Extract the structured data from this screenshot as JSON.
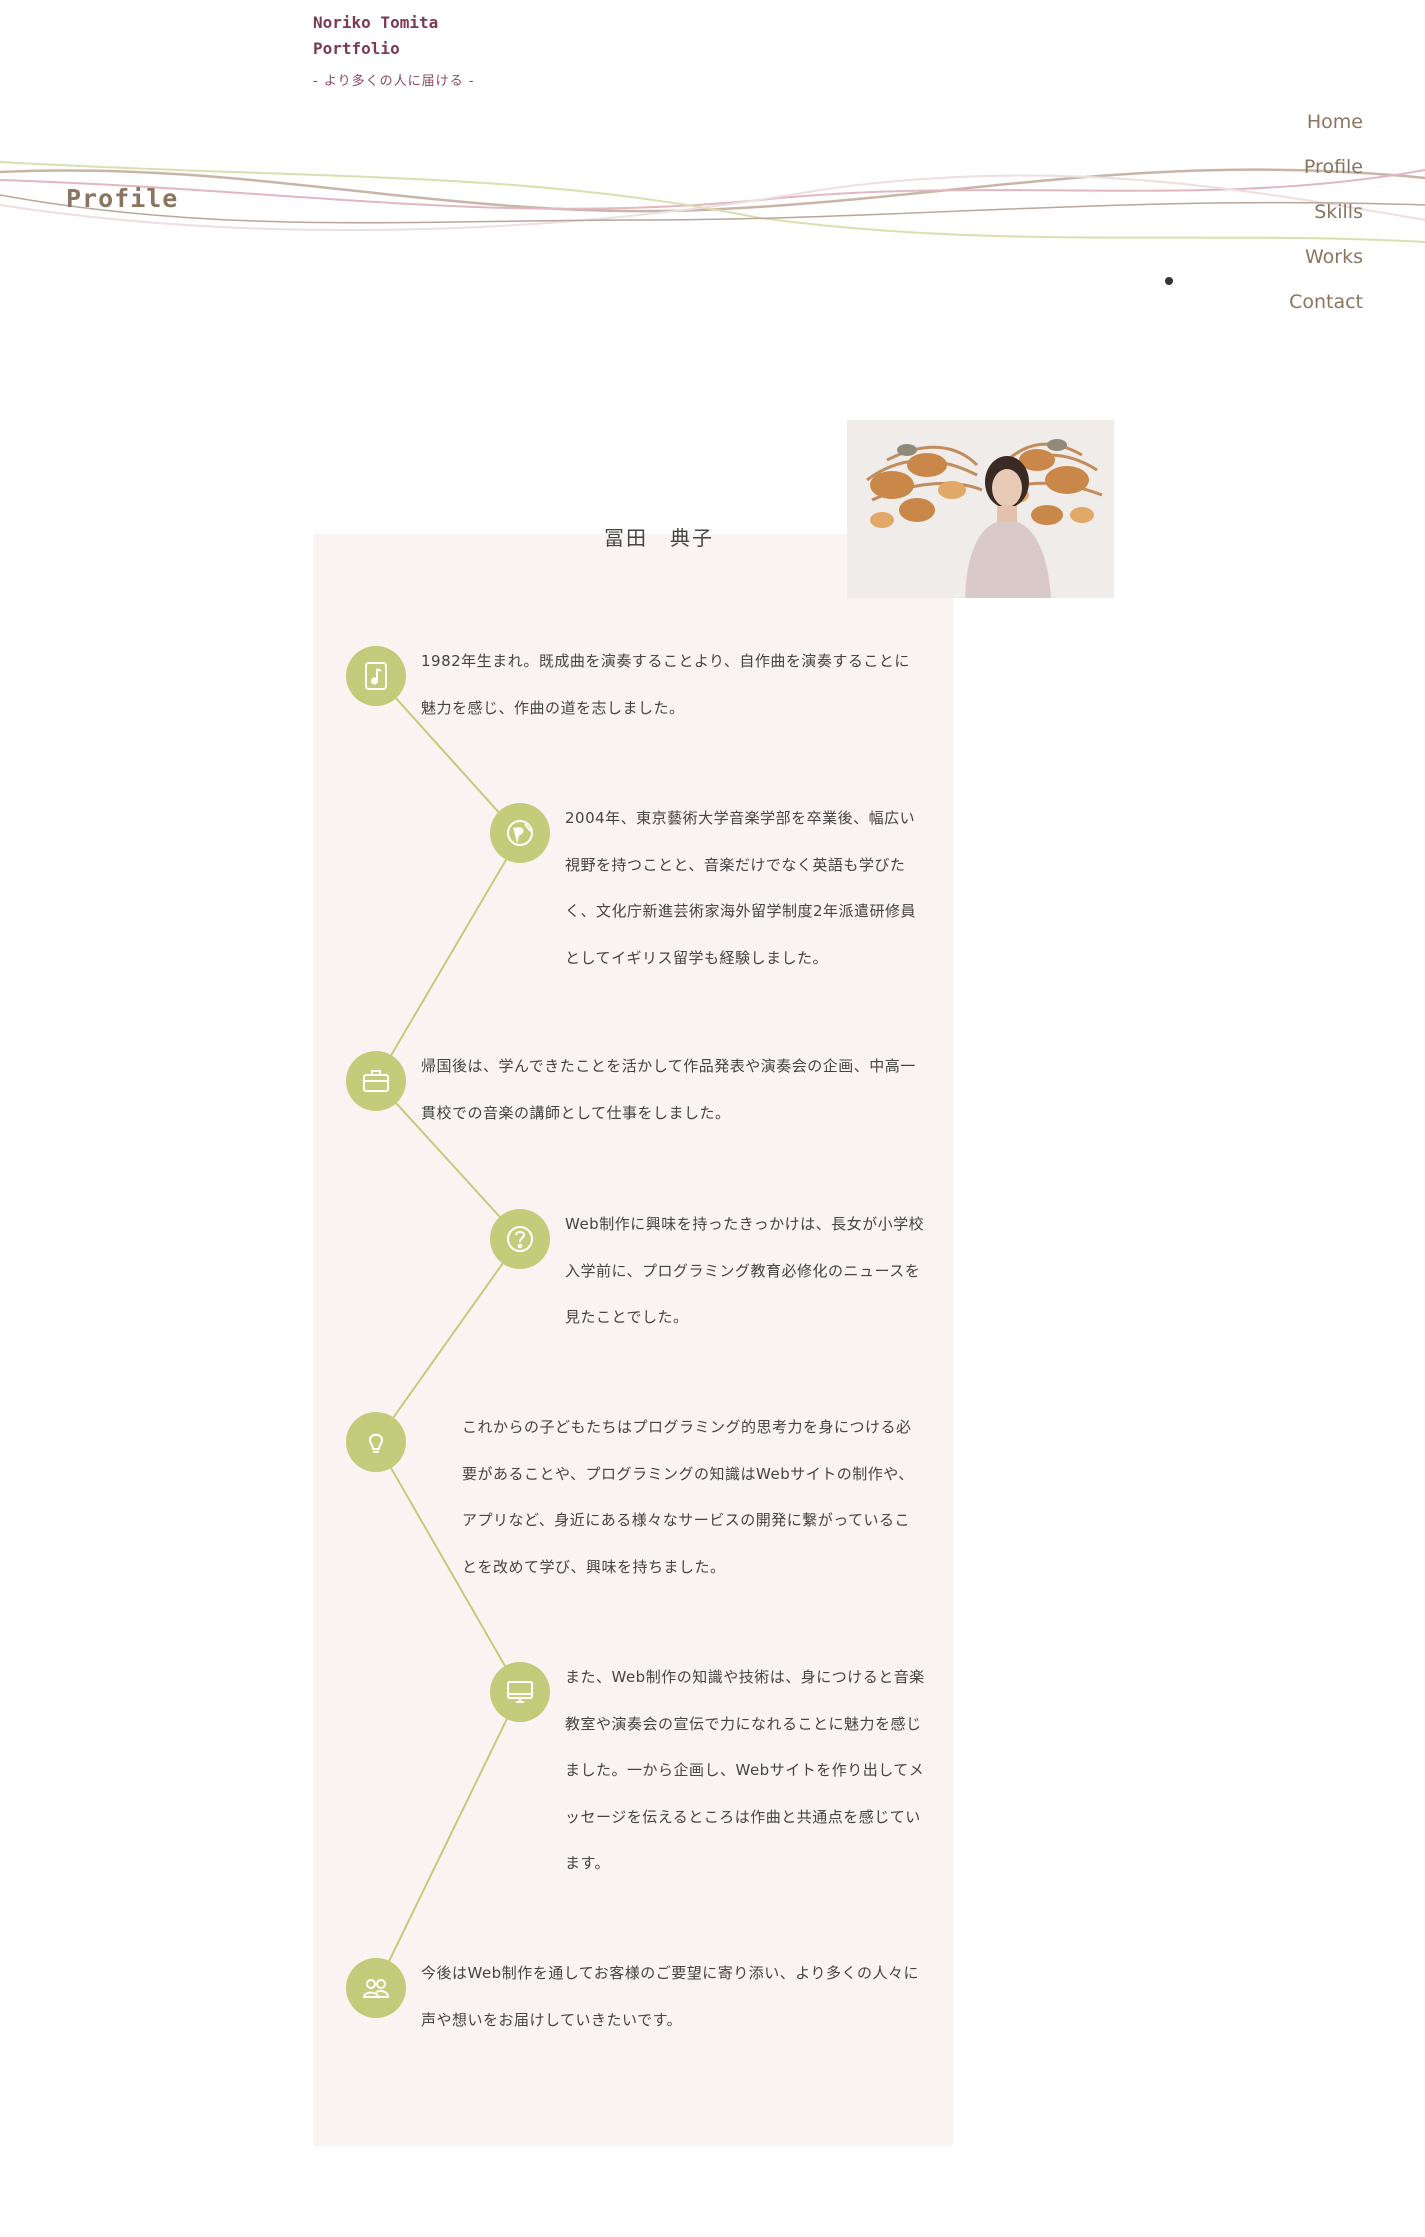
{
  "header": {
    "logo_line1": "Noriko Tomita",
    "logo_line2": "Portfolio",
    "tagline": "- より多くの人に届ける -"
  },
  "nav": {
    "items": [
      "Home",
      "Profile",
      "Skills",
      "Works",
      "Contact"
    ]
  },
  "section_title": "Profile",
  "profile": {
    "name": "冨田　典子",
    "timeline": [
      {
        "icon": "music-note-icon",
        "text": "1982年生まれ。既成曲を演奏することより、自作曲を演奏することに魅力を感じ、作曲の道を志しました。"
      },
      {
        "icon": "globe-icon",
        "text": "2004年、東京藝術大学音楽学部を卒業後、幅広い視野を持つことと、音楽だけでなく英語も学びたく、文化庁新進芸術家海外留学制度2年派遣研修員としてイギリス留学も経験しました。"
      },
      {
        "icon": "briefcase-icon",
        "text": "帰国後は、学んできたことを活かして作品発表や演奏会の企画、中高一貫校での音楽の講師として仕事をしました。"
      },
      {
        "icon": "question-icon",
        "text": "Web制作に興味を持ったきっかけは、長女が小学校入学前に、プログラミング教育必修化のニュースを見たことでした。"
      },
      {
        "icon": "lightbulb-icon",
        "text": "これからの子どもたちはプログラミング的思考力を身につける必要があることや、プログラミングの知識はWebサイトの制作や、アプリなど、身近にある様々なサービスの開発に繋がっていることを改めて学び、興味を持ちました。"
      },
      {
        "icon": "computer-icon",
        "text": "また、Web制作の知識や技術は、身につけると音楽教室や演奏会の宣伝で力になれることに魅力を感じました。一から企画し、Webサイトを作り出してメッセージを伝えるところは作曲と共通点を感じています。"
      },
      {
        "icon": "people-icon",
        "text": "今後はWeb制作を通してお客様のご要望に寄り添い、より多くの人々に声や想いをお届けしていきたいです。"
      }
    ]
  },
  "colors": {
    "accent_green": "#c3cc7a",
    "logo_maroon": "#7d3a4f",
    "nav_brown": "#8a7560",
    "card_bg": "#f9f3f2"
  }
}
